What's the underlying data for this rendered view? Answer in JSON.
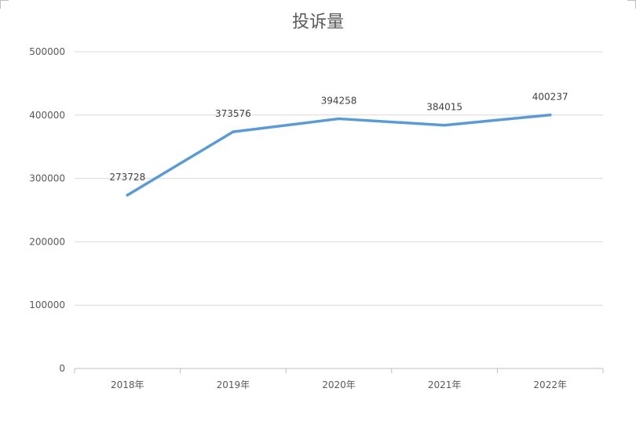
{
  "chart_data": {
    "type": "line",
    "title": "投诉量",
    "categories": [
      "2018年",
      "2019年",
      "2020年",
      "2021年",
      "2022年"
    ],
    "series": [
      {
        "values": [
          273728,
          373576,
          394258,
          384015,
          400237
        ],
        "color": "#5B9BD5"
      }
    ],
    "data_labels": [
      "273728",
      "373576",
      "394258",
      "384015",
      "400237"
    ],
    "y_ticks": [
      "0",
      "100000",
      "200000",
      "300000",
      "400000",
      "500000"
    ],
    "ylim": [
      0,
      500000
    ],
    "grid": true,
    "legend": "none"
  },
  "colors": {
    "line": "#5B9BD5",
    "grid": "#D9D9D9",
    "text": "#595959"
  }
}
